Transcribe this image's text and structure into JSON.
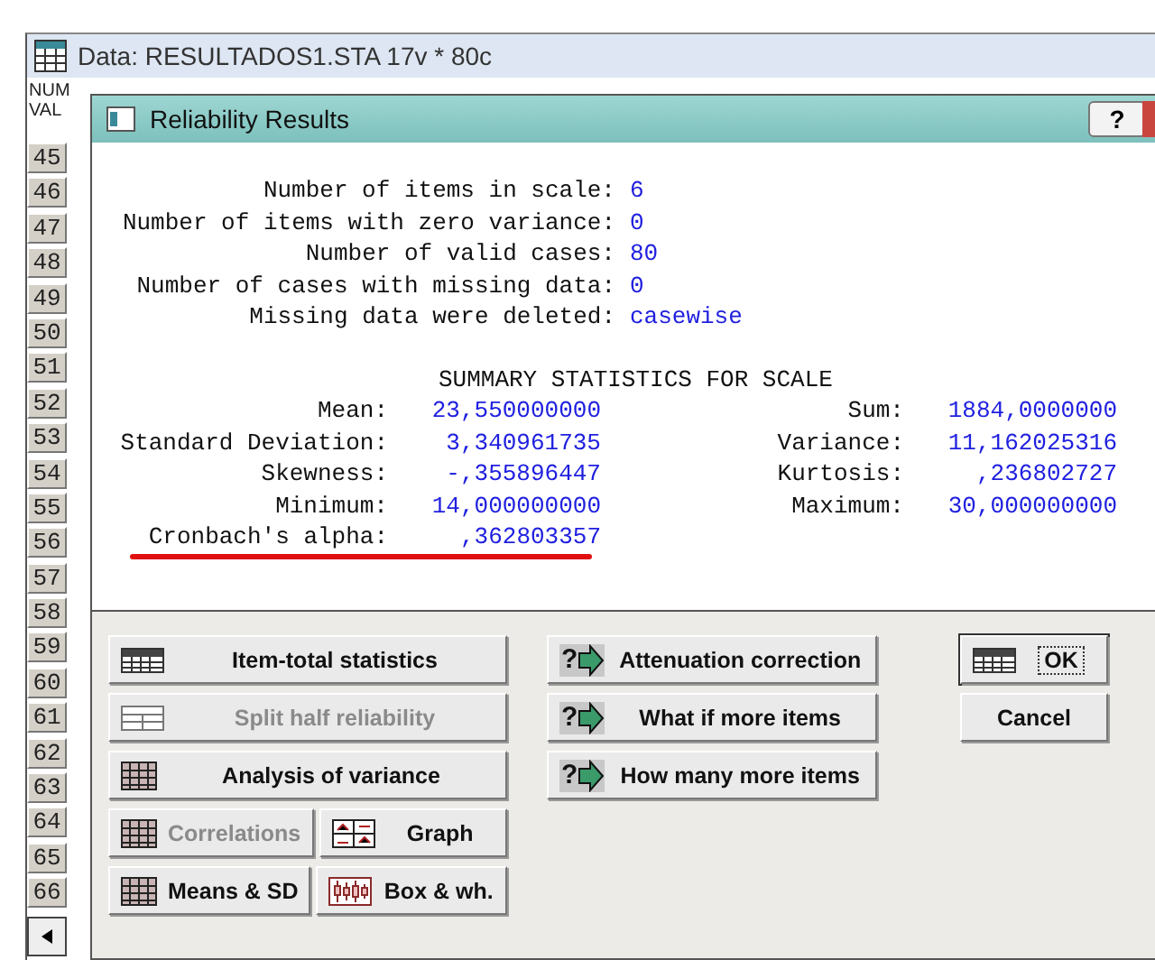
{
  "data_window": {
    "title": "Data: RESULTADOS1.STA 17v * 80c",
    "header_lines": [
      "NUM",
      "VAL"
    ],
    "row_numbers": [
      "45",
      "46",
      "47",
      "48",
      "49",
      "50",
      "51",
      "52",
      "53",
      "54",
      "55",
      "56",
      "57",
      "58",
      "59",
      "60",
      "61",
      "62",
      "63",
      "64",
      "65",
      "66"
    ]
  },
  "dialog": {
    "title": "Reliability Results",
    "help": "?",
    "report": [
      {
        "label": "Number of items in scale:",
        "value": "6"
      },
      {
        "label": "Number of items with zero variance:",
        "value": "0"
      },
      {
        "label": "Number of valid cases:",
        "value": "80"
      },
      {
        "label": "Number of cases with missing data:",
        "value": "0"
      },
      {
        "label": "Missing data were deleted:",
        "value": "casewise"
      }
    ],
    "summary_title": "SUMMARY STATISTICS FOR SCALE",
    "summary_left": [
      {
        "label": "Mean:",
        "value": "23,550000000",
        "highlighted": false
      },
      {
        "label": "Standard Deviation:",
        "value": "3,340961735",
        "highlighted": false
      },
      {
        "label": "Skewness:",
        "value": "-,355896447",
        "highlighted": false
      },
      {
        "label": "Minimum:",
        "value": "14,000000000",
        "highlighted": false
      },
      {
        "label": "Cronbach's alpha:",
        "value": ",362803357",
        "highlighted": true
      }
    ],
    "summary_right": [
      {
        "label": "Sum:",
        "value": "1884,0000000"
      },
      {
        "label": "Variance:",
        "value": "11,162025316"
      },
      {
        "label": "Kurtosis:",
        "value": ",236802727"
      },
      {
        "label": "Maximum:",
        "value": "30,000000000"
      }
    ],
    "left_buttons": [
      [
        {
          "label": "Item-total statistics",
          "kind": "summ",
          "disabled": false
        }
      ],
      [
        {
          "label": "Split half reliability",
          "kind": "split",
          "disabled": true
        }
      ],
      [
        {
          "label": "Analysis of variance",
          "kind": "grid",
          "disabled": false
        }
      ],
      [
        {
          "label": "Correlations",
          "kind": "grid",
          "disabled": true
        },
        {
          "label": "Graph",
          "kind": "graph",
          "disabled": false
        }
      ],
      [
        {
          "label": "Means & SD",
          "kind": "grid",
          "disabled": false
        },
        {
          "label": "Box & wh.",
          "kind": "box",
          "disabled": false
        }
      ]
    ],
    "middle_buttons": [
      {
        "label": "Attenuation correction",
        "icon_text": "?",
        "disabled": false
      },
      {
        "label": "What if more items",
        "icon_text": "?",
        "disabled": false
      },
      {
        "label": "How many more items",
        "icon_text": "?",
        "disabled": false
      }
    ],
    "right_buttons": [
      {
        "label": "OK",
        "kind": "summ",
        "selected": true
      },
      {
        "label": "Cancel",
        "kind": "plain",
        "selected": false
      }
    ]
  }
}
